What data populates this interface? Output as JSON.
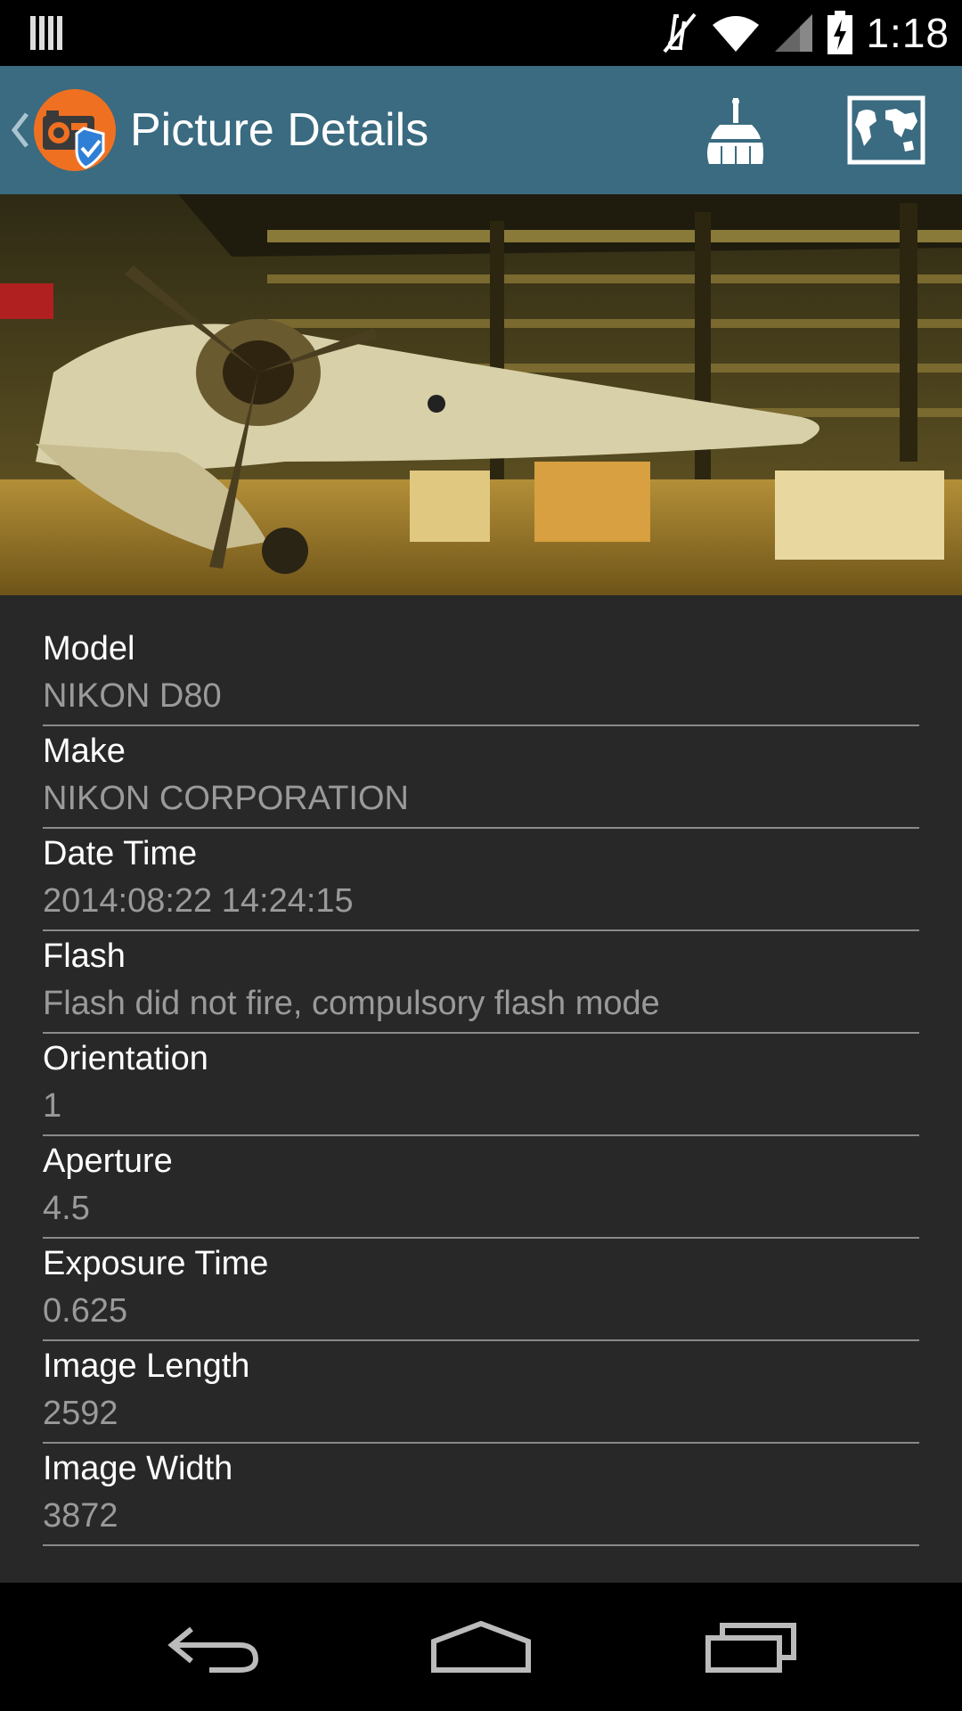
{
  "status_bar": {
    "time": "1:18",
    "icons": [
      "notification-bars-icon",
      "mute-icon",
      "wifi-icon",
      "cell-signal-icon",
      "battery-charging-icon"
    ]
  },
  "app_bar": {
    "title": "Picture Details",
    "bg_color": "#3a6b80",
    "actions": [
      "broom-clean-icon",
      "world-map-icon"
    ]
  },
  "photo": {
    "icon": "airplane-photo"
  },
  "details": [
    {
      "label": "Model",
      "value": "NIKON D80"
    },
    {
      "label": "Make",
      "value": "NIKON CORPORATION"
    },
    {
      "label": "Date Time",
      "value": "2014:08:22 14:24:15"
    },
    {
      "label": "Flash",
      "value": "Flash did not fire, compulsory flash mode"
    },
    {
      "label": "Orientation",
      "value": "1"
    },
    {
      "label": "Aperture",
      "value": "4.5"
    },
    {
      "label": "Exposure Time",
      "value": "0.625"
    },
    {
      "label": "Image Length",
      "value": "2592"
    },
    {
      "label": "Image Width",
      "value": "3872"
    }
  ],
  "nav_bar": {
    "buttons": [
      "back-icon",
      "home-icon",
      "recents-icon"
    ]
  }
}
